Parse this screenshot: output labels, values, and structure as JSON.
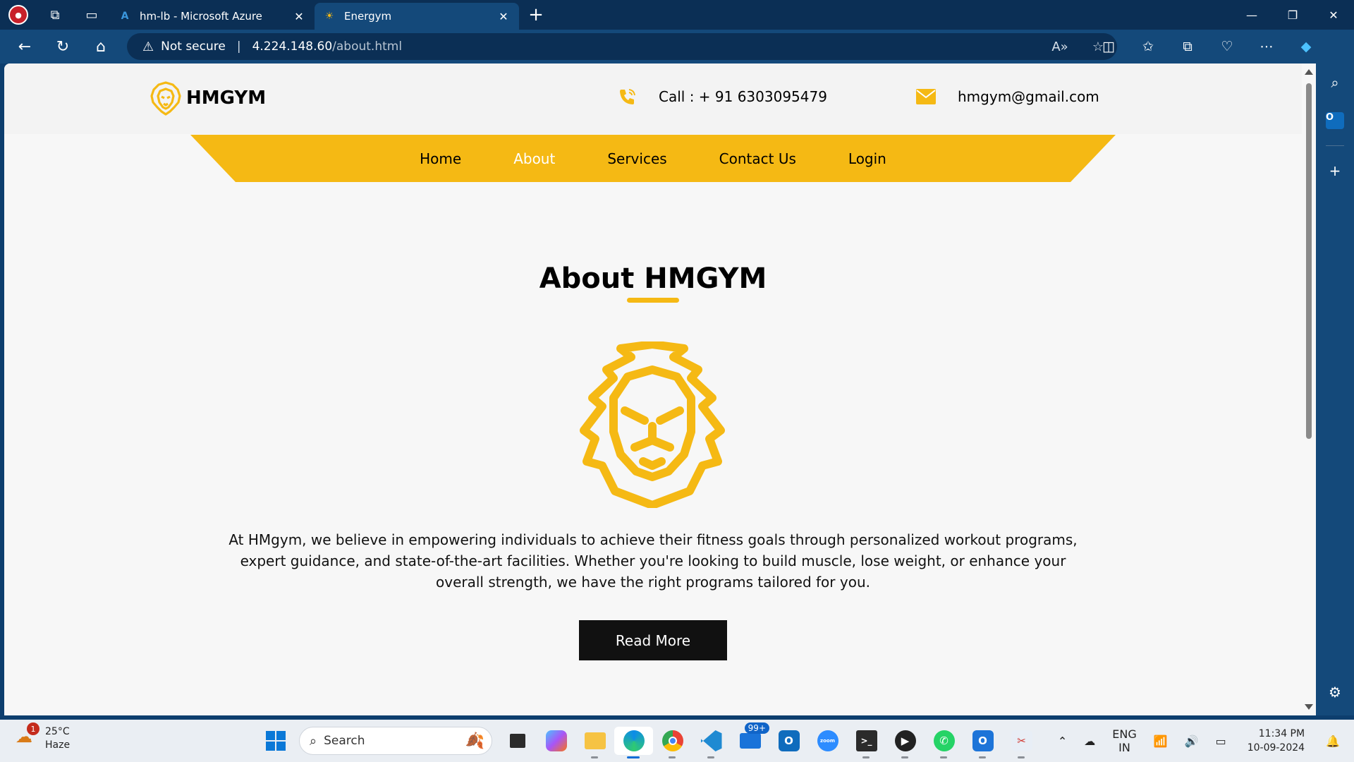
{
  "browser": {
    "tabs": [
      {
        "title": "hm-lb - Microsoft Azure",
        "favicon": "azure-icon",
        "active": false
      },
      {
        "title": "Energym",
        "favicon": "lion-icon",
        "active": true
      }
    ],
    "address": {
      "security_label": "Not secure",
      "host": "4.224.148.60",
      "path": "/about.html"
    }
  },
  "site": {
    "brand": "HMGYM",
    "phone_label": "Call : + 91 6303095479",
    "email_label": "hmgym@gmail.com",
    "accent_color": "#f5b914",
    "nav": [
      {
        "label": "Home",
        "current": false
      },
      {
        "label": "About",
        "current": true
      },
      {
        "label": "Services",
        "current": false
      },
      {
        "label": "Contact Us",
        "current": false
      },
      {
        "label": "Login",
        "current": false
      }
    ],
    "about": {
      "title": "About HMGYM",
      "body": "At HMgym, we believe in empowering individuals to achieve their fitness goals through personalized workout programs, expert guidance, and state-of-the-art facilities. Whether you're looking to build muscle, lose weight, or enhance your overall strength, we have the right programs tailored for you.",
      "button_label": "Read More"
    }
  },
  "taskbar": {
    "weather_temp": "25°C",
    "weather_desc": "Haze",
    "weather_badge": "1",
    "search_label": "Search",
    "mail_badge": "99+",
    "zoom_label": "zoom",
    "lang_top": "ENG",
    "lang_bottom": "IN",
    "time": "11:34 PM",
    "date": "10-09-2024"
  }
}
